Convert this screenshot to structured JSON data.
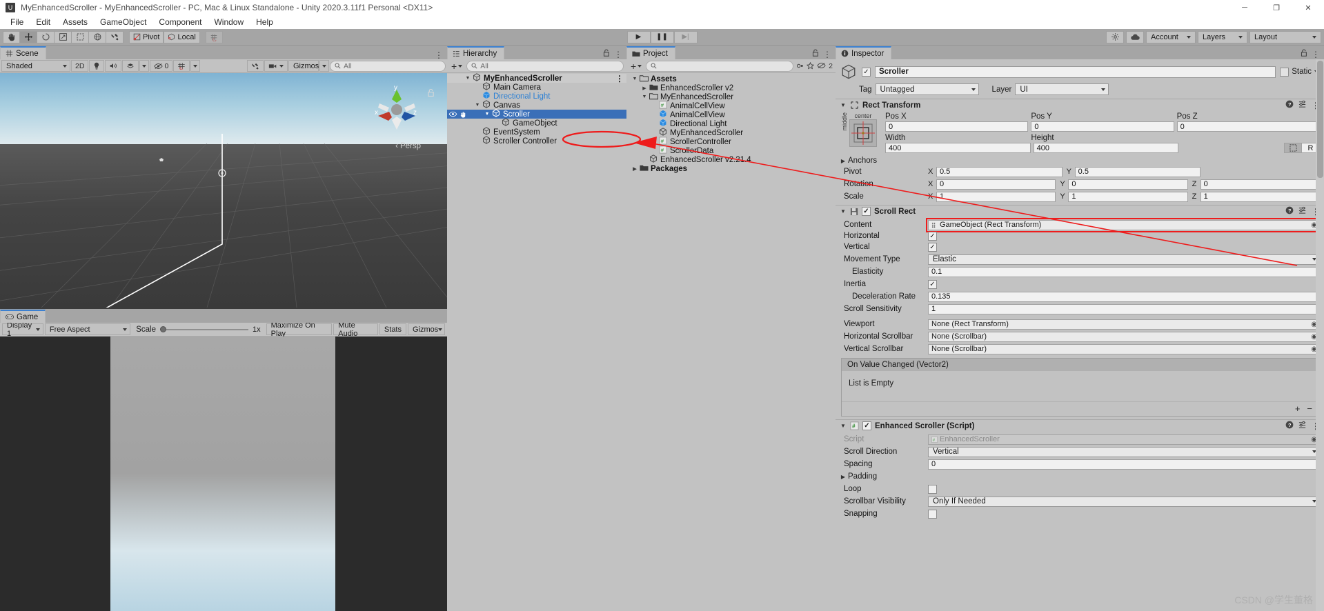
{
  "window": {
    "title": "MyEnhancedScroller - MyEnhancedScroller - PC, Mac & Linux Standalone - Unity 2020.3.11f1 Personal <DX11>",
    "app_icon": "unity-icon",
    "minimize": "─",
    "maximize": "❐",
    "close": "✕"
  },
  "menubar": {
    "items": [
      "File",
      "Edit",
      "Assets",
      "GameObject",
      "Component",
      "Window",
      "Help"
    ]
  },
  "toolbar": {
    "tools": [
      "hand-tool",
      "move-tool",
      "rotate-tool",
      "scale-tool",
      "rect-tool",
      "transform-tool",
      "custom-tool"
    ],
    "pivot_label": "Pivot",
    "local_label": "Local",
    "grid_label": "grid-snap",
    "play_label": "▶",
    "pause_label": "❚❚",
    "step_label": "▶|",
    "cloud_label": "cloud-icon",
    "services_label": "services-icon",
    "account_label": "Account",
    "layers_label": "Layers",
    "layout_label": "Layout"
  },
  "scene": {
    "tab_label": "Scene",
    "tab_icon": "scene-grid-icon",
    "shading_mode": "Shaded",
    "mode_2d": "2D",
    "lighting_icon": "lighting-icon",
    "audio_icon": "audio-icon",
    "fx_icon": "effects-icon",
    "hidden_count": "0",
    "grid_icon": "grid-visibility-icon",
    "tools_icon": "component-tools-icon",
    "camera_icon": "scene-camera-icon",
    "gizmos_label": "Gizmos",
    "search_placeholder": "All",
    "persp_label": "Persp",
    "axis_x": "x",
    "axis_y": "y",
    "axis_z": "z",
    "lock_icon": "unlocked-icon"
  },
  "game": {
    "tab_label": "Game",
    "tab_icon": "game-pad-icon",
    "display": "Display 1",
    "aspect": "Free Aspect",
    "scale_label": "Scale",
    "scale_value": "1x",
    "maximize_label": "Maximize On Play",
    "mute_label": "Mute Audio",
    "stats_label": "Stats",
    "gizmos_label": "Gizmos"
  },
  "hierarchy": {
    "tab_label": "Hierarchy",
    "tab_icon": "hierarchy-icon",
    "lock_icon": "lock-icon",
    "menu_icon": "kebab-icon",
    "add_label": "+",
    "search_placeholder": "All",
    "items": [
      {
        "label": "MyEnhancedScroller",
        "indent": 0,
        "arrow": "▼",
        "icon": "unity-scene-icon",
        "bold": true,
        "selected": false,
        "kind": "scene"
      },
      {
        "label": "Main Camera",
        "indent": 1,
        "arrow": "",
        "icon": "gameobject-icon",
        "bold": false,
        "selected": false,
        "kind": "go"
      },
      {
        "label": "Directional Light",
        "indent": 1,
        "arrow": "",
        "icon": "prefab-icon",
        "bold": false,
        "selected": false,
        "kind": "prefab"
      },
      {
        "label": "Canvas",
        "indent": 1,
        "arrow": "▼",
        "icon": "gameobject-icon",
        "bold": false,
        "selected": false,
        "kind": "go"
      },
      {
        "label": "Scroller",
        "indent": 2,
        "arrow": "▼",
        "icon": "gameobject-icon",
        "bold": false,
        "selected": true,
        "kind": "go"
      },
      {
        "label": "GameObject",
        "indent": 3,
        "arrow": "",
        "icon": "gameobject-icon",
        "bold": false,
        "selected": false,
        "kind": "go"
      },
      {
        "label": "EventSystem",
        "indent": 1,
        "arrow": "",
        "icon": "gameobject-icon",
        "bold": false,
        "selected": false,
        "kind": "go"
      },
      {
        "label": "Scroller Controller",
        "indent": 1,
        "arrow": "",
        "icon": "gameobject-icon",
        "bold": false,
        "selected": false,
        "kind": "go"
      }
    ]
  },
  "project": {
    "tab_label": "Project",
    "tab_icon": "folder-icon",
    "lock_icon": "lock-icon",
    "menu_icon": "kebab-icon",
    "add_label": "+",
    "search_placeholder": "",
    "view_count": "2",
    "items": [
      {
        "label": "Assets",
        "indent": 0,
        "arrow": "▼",
        "icon": "folder-open-icon",
        "bold": true
      },
      {
        "label": "EnhancedScroller v2",
        "indent": 1,
        "arrow": "▶",
        "icon": "folder-icon",
        "bold": false
      },
      {
        "label": "MyEnhancedScroller",
        "indent": 1,
        "arrow": "▼",
        "icon": "folder-open-icon",
        "bold": false
      },
      {
        "label": "AnimalCellView",
        "indent": 2,
        "arrow": "",
        "icon": "cs-script-icon",
        "bold": false
      },
      {
        "label": "AnimalCellView",
        "indent": 2,
        "arrow": "",
        "icon": "prefab-icon",
        "bold": false
      },
      {
        "label": "Directional Light",
        "indent": 2,
        "arrow": "",
        "icon": "prefab-icon",
        "bold": false
      },
      {
        "label": "MyEnhancedScroller",
        "indent": 2,
        "arrow": "",
        "icon": "unity-scene-icon",
        "bold": false
      },
      {
        "label": "ScrollerController",
        "indent": 2,
        "arrow": "",
        "icon": "cs-script-icon",
        "bold": false
      },
      {
        "label": "ScrollerData",
        "indent": 2,
        "arrow": "",
        "icon": "cs-script-icon",
        "bold": false
      },
      {
        "label": "EnhancedScroller v2.21.4",
        "indent": 1,
        "arrow": "",
        "icon": "unity-scene-icon",
        "bold": false
      },
      {
        "label": "Packages",
        "indent": 0,
        "arrow": "▶",
        "icon": "folder-icon",
        "bold": true
      }
    ]
  },
  "inspector": {
    "tab_label": "Inspector",
    "tab_icon": "info-icon",
    "lock_icon": "lock-icon",
    "menu_icon": "kebab-icon",
    "object_name": "Scroller",
    "object_enabled": true,
    "static_label": "Static",
    "tag_label": "Tag",
    "tag_value": "Untagged",
    "layer_label": "Layer",
    "layer_value": "UI",
    "rect_transform": {
      "title": "Rect Transform",
      "anchor_preset_h": "center",
      "anchor_preset_v": "middle",
      "pos_x_label": "Pos X",
      "pos_x": "0",
      "pos_y_label": "Pos Y",
      "pos_y": "0",
      "pos_z_label": "Pos Z",
      "pos_z": "0",
      "width_label": "Width",
      "width": "400",
      "height_label": "Height",
      "height": "400",
      "blueprint_icon": "blueprint-icon",
      "raw_label": "R",
      "anchors_label": "Anchors",
      "pivot_label": "Pivot",
      "pivot_x": "0.5",
      "pivot_y": "0.5",
      "rotation_label": "Rotation",
      "rot_x": "0",
      "rot_y": "0",
      "rot_z": "0",
      "scale_label": "Scale",
      "scale_x": "1",
      "scale_y": "1",
      "scale_z": "1"
    },
    "scroll_rect": {
      "title": "Scroll Rect",
      "enabled": true,
      "content_label": "Content",
      "content_value": "GameObject (Rect Transform)",
      "horizontal_label": "Horizontal",
      "horizontal": true,
      "vertical_label": "Vertical",
      "vertical": true,
      "movement_type_label": "Movement Type",
      "movement_type": "Elastic",
      "elasticity_label": "Elasticity",
      "elasticity": "0.1",
      "inertia_label": "Inertia",
      "inertia": true,
      "deceleration_label": "Deceleration Rate",
      "deceleration": "0.135",
      "sensitivity_label": "Scroll Sensitivity",
      "sensitivity": "1",
      "viewport_label": "Viewport",
      "viewport_value": "None (Rect Transform)",
      "hscrollbar_label": "Horizontal Scrollbar",
      "hscrollbar_value": "None (Scrollbar)",
      "vscrollbar_label": "Vertical Scrollbar",
      "vscrollbar_value": "None (Scrollbar)",
      "event_title": "On Value Changed (Vector2)",
      "event_empty": "List is Empty",
      "add_btn": "+",
      "remove_btn": "−"
    },
    "enhanced_scroller": {
      "title": "Enhanced Scroller (Script)",
      "enabled": true,
      "script_label": "Script",
      "script_value": "EnhancedScroller",
      "direction_label": "Scroll Direction",
      "direction": "Vertical",
      "spacing_label": "Spacing",
      "spacing": "0",
      "padding_label": "Padding",
      "loop_label": "Loop",
      "loop": false,
      "scrollbar_visibility_label": "Scrollbar Visibility",
      "scrollbar_visibility": "Only If Needed",
      "snapping_label": "Snapping",
      "snapping": false
    }
  },
  "watermark": "CSDN @学生董格",
  "colors": {
    "selection_blue": "#3a6fb8",
    "accent_red": "#ee1c1c",
    "panel_bg": "#c2c2c2",
    "toolbar_bg": "#a5a5a5"
  }
}
